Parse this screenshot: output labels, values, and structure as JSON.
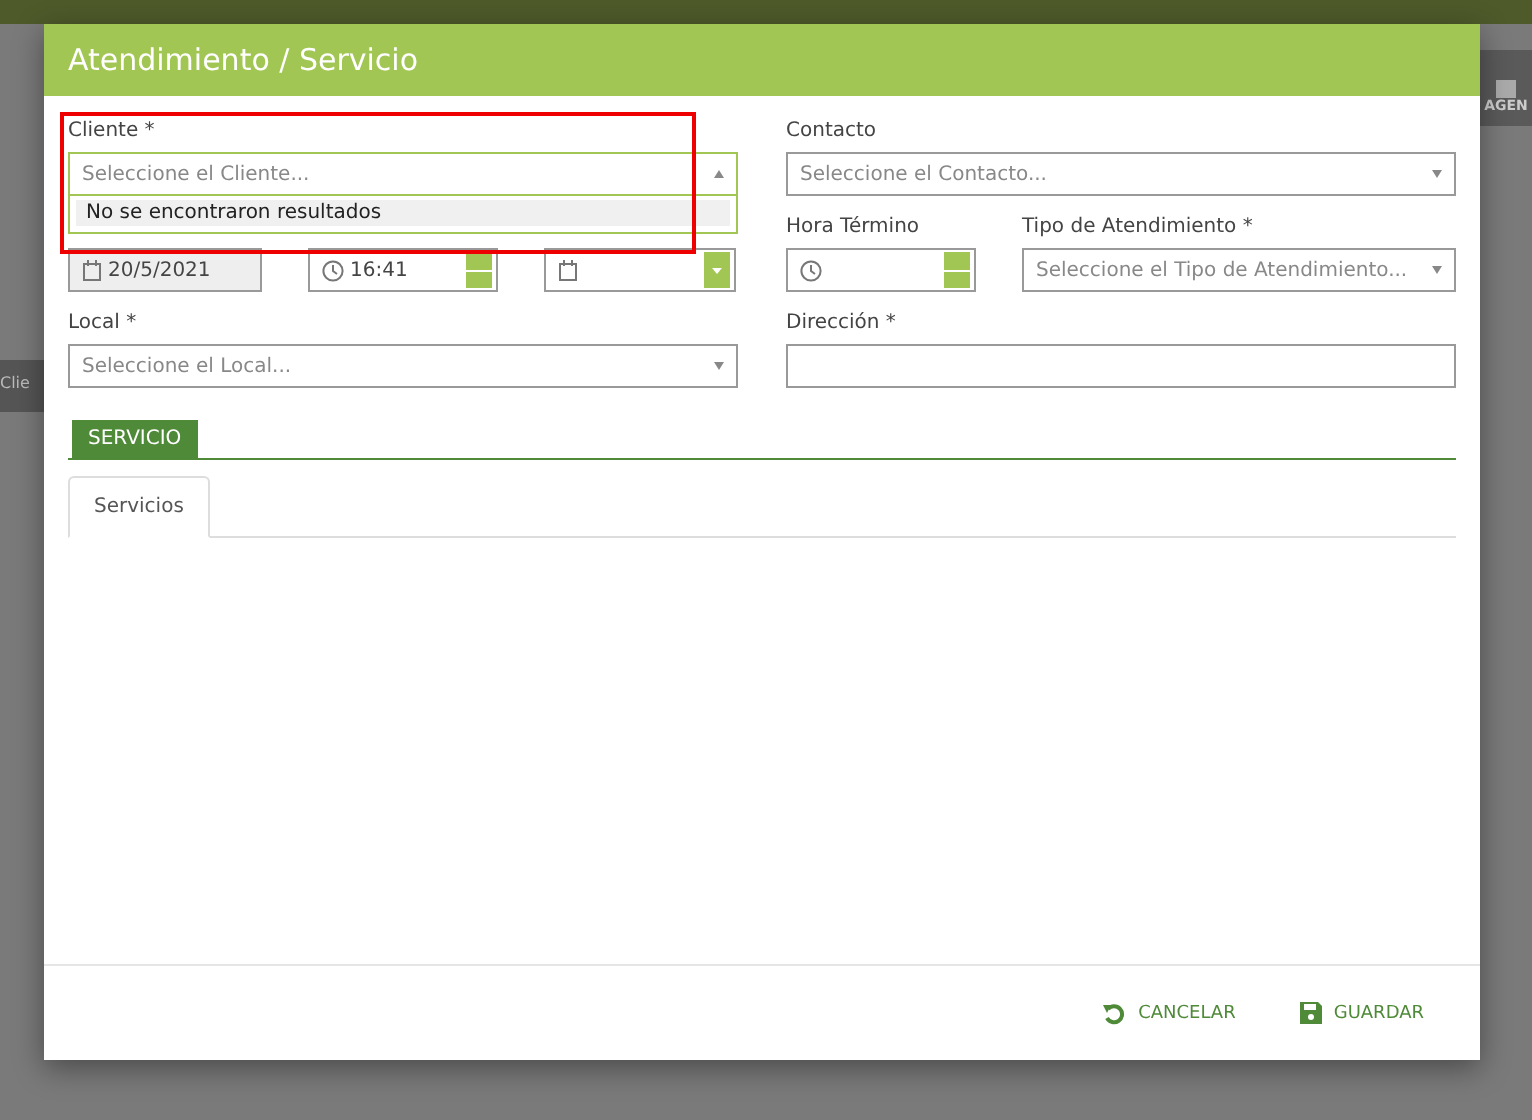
{
  "background": {
    "left_text": "Clie",
    "right_text": "AGEN"
  },
  "dialog": {
    "title": "Atendimiento / Servicio"
  },
  "cliente": {
    "label": "Cliente *",
    "placeholder": "Seleccione el Cliente...",
    "expanded": true,
    "results": "No se encontraron resultados"
  },
  "contacto": {
    "label": "Contacto",
    "placeholder": "Seleccione el Contacto..."
  },
  "fecha_inicio": {
    "value": "20/5/2021",
    "disabled": true
  },
  "hora_inicio": {
    "value": "16:41"
  },
  "hora_termino": {
    "label": "Hora Término"
  },
  "tipo": {
    "label": "Tipo de Atendimiento *",
    "placeholder": "Seleccione el Tipo de Atendimiento..."
  },
  "local": {
    "label": "Local *",
    "placeholder": "Seleccione el Local..."
  },
  "direccion": {
    "label": "Dirección *"
  },
  "section": "SERVICIO",
  "tabs": [
    {
      "label": "Servicios",
      "selected": true
    }
  ],
  "buttons": [
    {
      "kind": "cancel",
      "label": "CANCELAR"
    },
    {
      "kind": "save",
      "label": "GUARDAR"
    }
  ]
}
